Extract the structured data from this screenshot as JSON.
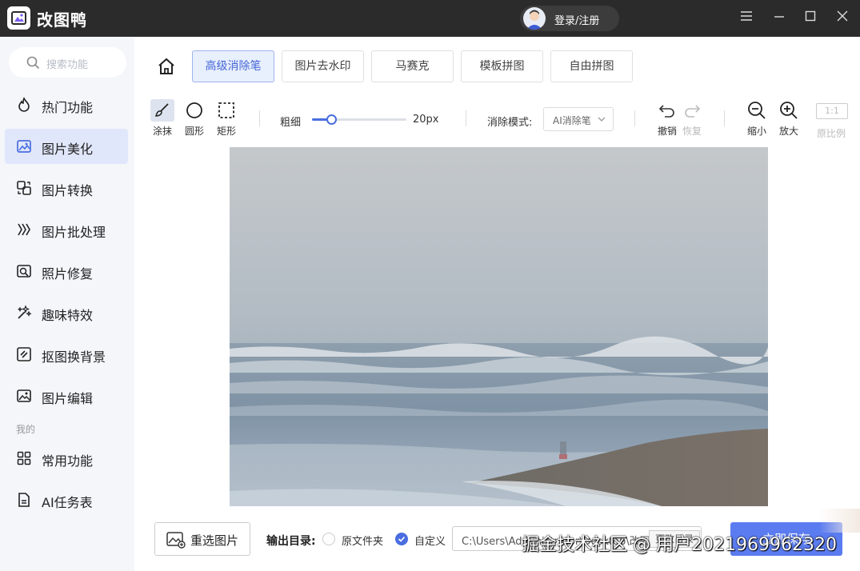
{
  "app": {
    "title": "改图鸭",
    "login": "登录/注册"
  },
  "search": {
    "placeholder": "搜索功能"
  },
  "sidebar": {
    "items": [
      {
        "label": "热门功能",
        "icon": "hot-icon"
      },
      {
        "label": "图片美化",
        "icon": "image-beautify-icon",
        "active": true
      },
      {
        "label": "图片转换",
        "icon": "convert-icon"
      },
      {
        "label": "图片批处理",
        "icon": "batch-icon"
      },
      {
        "label": "照片修复",
        "icon": "repair-icon"
      },
      {
        "label": "趣味特效",
        "icon": "effects-icon"
      },
      {
        "label": "抠图换背景",
        "icon": "cutout-icon"
      },
      {
        "label": "图片编辑",
        "icon": "edit-icon"
      }
    ],
    "section_mine": "我的",
    "mine_items": [
      {
        "label": "常用功能",
        "icon": "grid-icon"
      },
      {
        "label": "AI任务表",
        "icon": "task-list-icon"
      }
    ]
  },
  "tabs": [
    "高级消除笔",
    "图片去水印",
    "马赛克",
    "模板拼图",
    "自由拼图"
  ],
  "active_tab": 0,
  "toolbar": {
    "tools": [
      {
        "label": "涂抹",
        "icon": "brush-icon",
        "active": true
      },
      {
        "label": "圆形",
        "icon": "circle-icon"
      },
      {
        "label": "矩形",
        "icon": "rect-select-icon"
      }
    ],
    "size_label": "粗细",
    "size_value": "20px",
    "size_fraction": 0.2,
    "mode_label": "消除模式:",
    "mode_value": "AI消除笔",
    "undo": "撤销",
    "redo": "恢复",
    "zoom_out": "缩小",
    "zoom_in": "放大",
    "ratio_icon": "1:1",
    "ratio_label": "原比例"
  },
  "bottom": {
    "reselect": "重选图片",
    "output_label": "输出目录:",
    "option_original": "原文件夹",
    "option_custom": "自定义",
    "path": "C:\\Users\\Administrator\\Desktop\\改图鸭",
    "change_dir": "更改目录",
    "start": "立即保存"
  },
  "watermark": "掘金技术社区 @ 用户2021969962320",
  "colors": {
    "accent": "#4a6ee0",
    "active_bg": "#e1e7fb",
    "titlebar": "#2b2b2b"
  }
}
